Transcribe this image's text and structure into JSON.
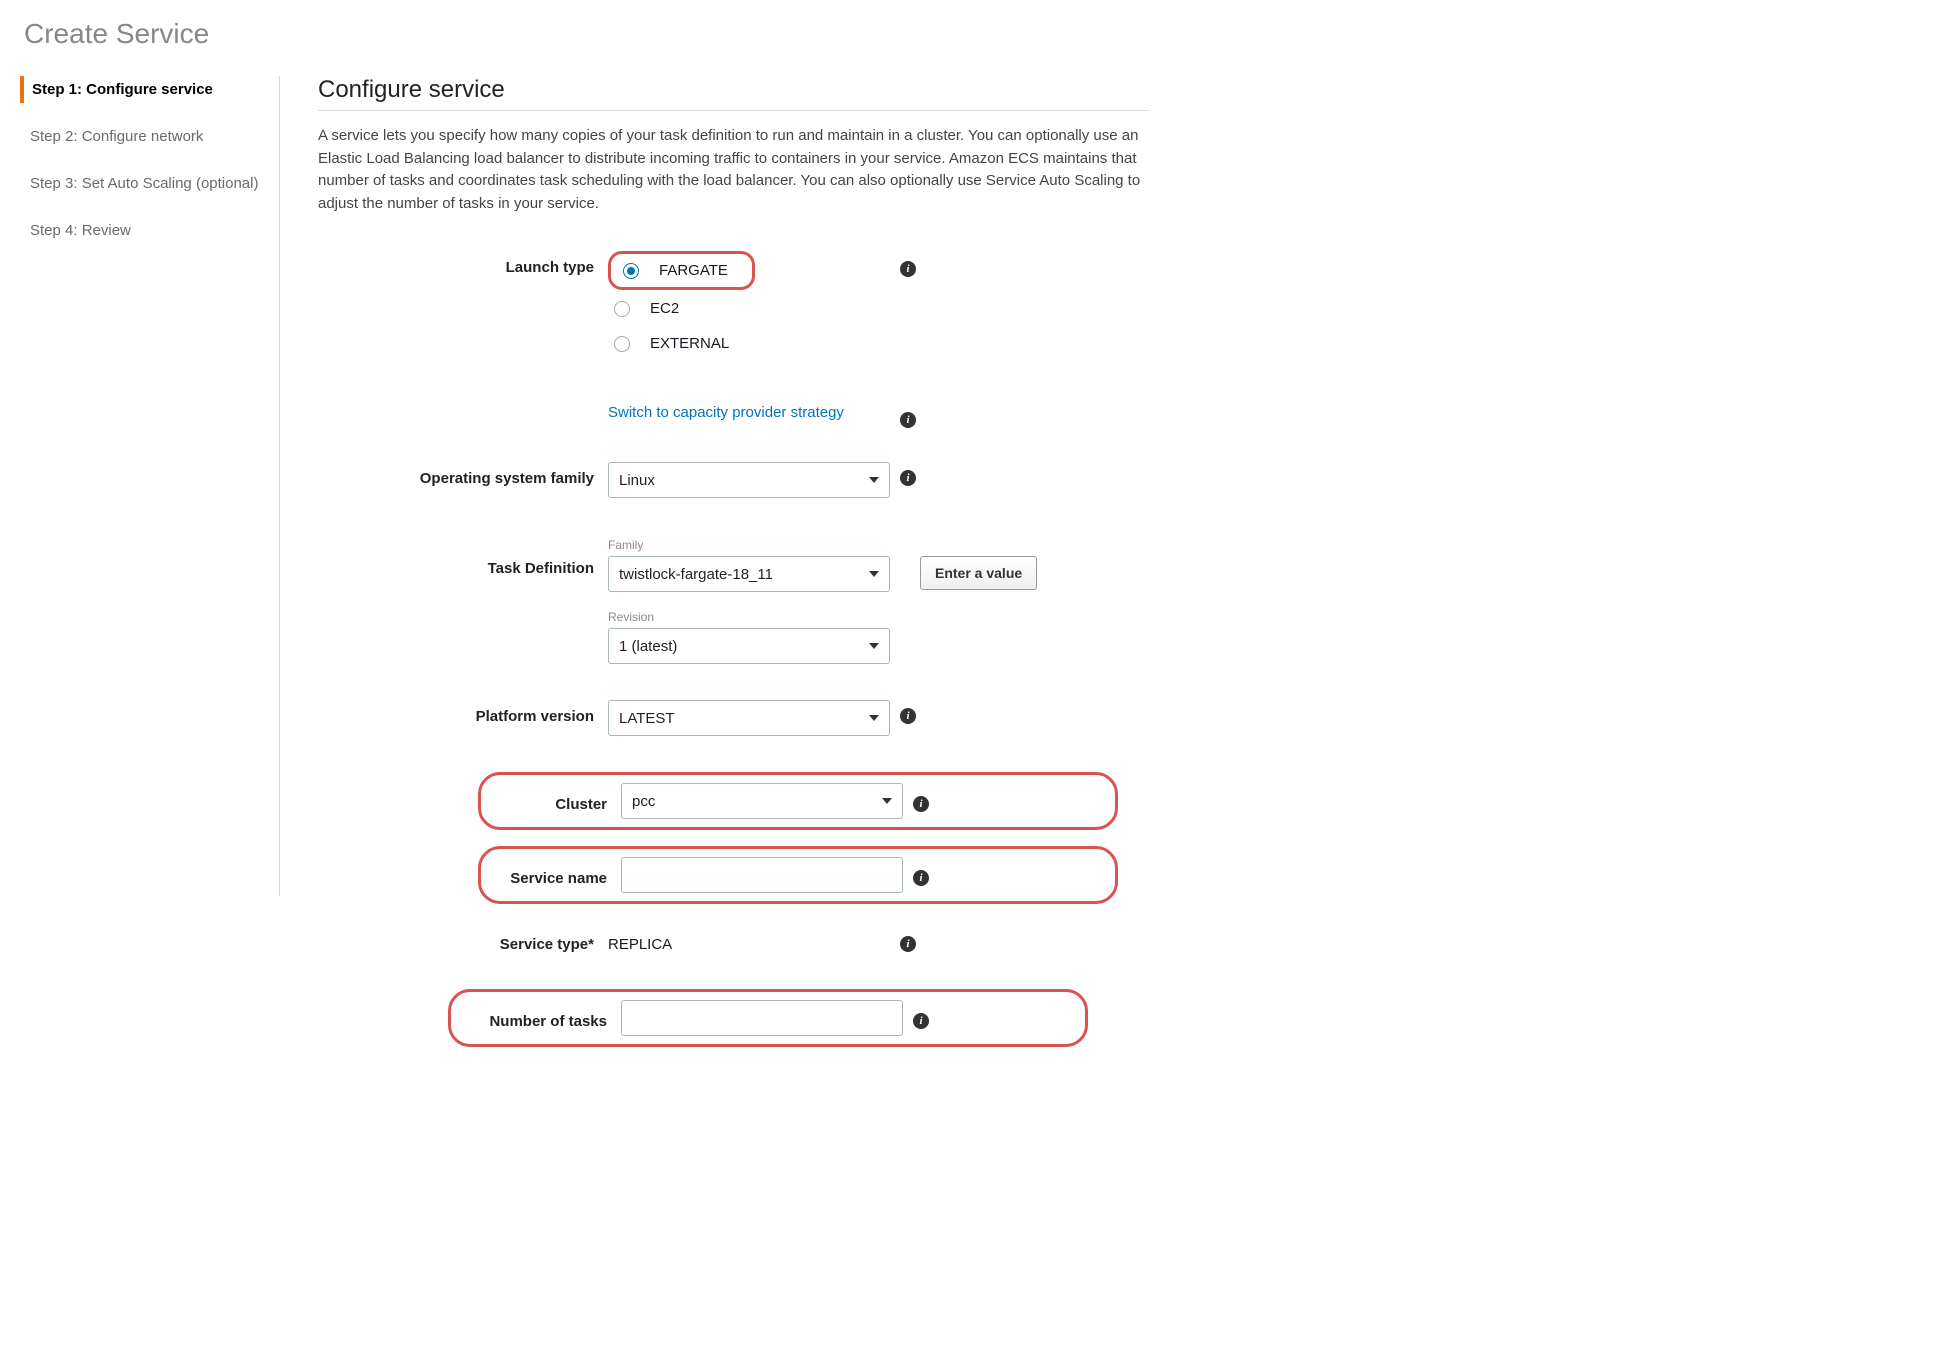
{
  "page": {
    "title": "Create Service"
  },
  "steps": {
    "items": [
      {
        "label": "Step 1: Configure service",
        "active": true
      },
      {
        "label": "Step 2: Configure network",
        "active": false
      },
      {
        "label": "Step 3: Set Auto Scaling (optional)",
        "active": false
      },
      {
        "label": "Step 4: Review",
        "active": false
      }
    ]
  },
  "section": {
    "title": "Configure service",
    "intro": "A service lets you specify how many copies of your task definition to run and maintain in a cluster. You can optionally use an Elastic Load Balancing load balancer to distribute incoming traffic to containers in your service. Amazon ECS maintains that number of tasks and coordinates task scheduling with the load balancer. You can also optionally use Service Auto Scaling to adjust the number of tasks in your service."
  },
  "form": {
    "launch_type": {
      "label": "Launch type",
      "options": [
        {
          "label": "FARGATE",
          "selected": true
        },
        {
          "label": "EC2",
          "selected": false
        },
        {
          "label": "EXTERNAL",
          "selected": false
        }
      ]
    },
    "capacity_link": "Switch to capacity provider strategy",
    "os_family": {
      "label": "Operating system family",
      "value": "Linux"
    },
    "task_definition": {
      "label": "Task Definition",
      "family_sublabel": "Family",
      "family_value": "twistlock-fargate-18_11",
      "revision_sublabel": "Revision",
      "revision_value": "1 (latest)",
      "enter_value_btn": "Enter a value"
    },
    "platform_version": {
      "label": "Platform version",
      "value": "LATEST"
    },
    "cluster": {
      "label": "Cluster",
      "value": "pcc"
    },
    "service_name": {
      "label": "Service name",
      "value": ""
    },
    "service_type": {
      "label": "Service type*",
      "value": "REPLICA"
    },
    "num_tasks": {
      "label": "Number of tasks",
      "value": ""
    }
  },
  "icons": {
    "info": "i"
  }
}
